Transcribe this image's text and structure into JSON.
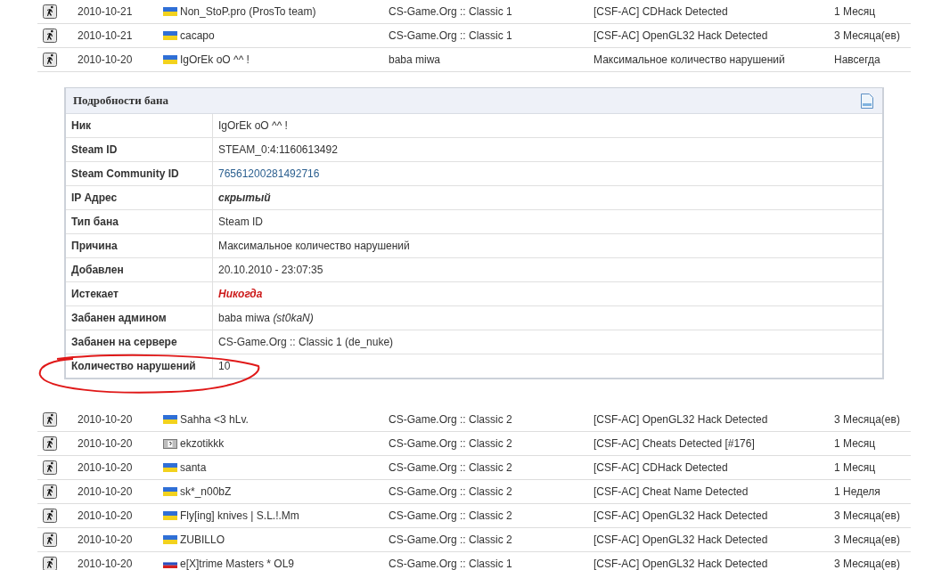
{
  "bans_top": [
    {
      "date": "2010-10-21",
      "kind": "ua",
      "nick": "Non_StoP.pro (ProsTo team)",
      "server": "CS-Game.Org :: Classic 1",
      "reason": "[CSF-AC] CDHack Detected",
      "length": "1 Месяц"
    },
    {
      "date": "2010-10-21",
      "kind": "ua",
      "nick": "cacapo",
      "server": "CS-Game.Org :: Classic 1",
      "reason": "[CSF-AC] OpenGL32 Hack Detected",
      "length": "3 Месяца(ев)"
    },
    {
      "date": "2010-10-20",
      "kind": "ua",
      "nick": "IgOrEk oO ^^ !",
      "server": "baba miwa",
      "reason": "Максимальное количество нарушений",
      "length": "Навсегда"
    }
  ],
  "details": {
    "title": "Подробности бана",
    "rows": [
      {
        "label": "Ник",
        "value": "IgOrEk oO ^^ !",
        "kind": "plain"
      },
      {
        "label": "Steam ID",
        "value": "STEAM_0:4:1160613492",
        "kind": "plain"
      },
      {
        "label": "Steam Community ID",
        "value": "76561200281492716",
        "kind": "link"
      },
      {
        "label": "IP Адрес",
        "value": "скрытый",
        "kind": "hidden"
      },
      {
        "label": "Тип бана",
        "value": "Steam ID",
        "kind": "plain"
      },
      {
        "label": "Причина",
        "value": "Максимальное количество нарушений",
        "kind": "plain"
      },
      {
        "label": "Добавлен",
        "value": "20.10.2010 - 23:07:35",
        "kind": "plain"
      },
      {
        "label": "Истекает",
        "value": "Никогда",
        "kind": "alert"
      },
      {
        "label": "Забанен админом",
        "value": "baba miwa *(st0kaN)*",
        "kind": "plain"
      },
      {
        "label": "Забанен на сервере",
        "value": "CS-Game.Org :: Classic 1 (de_nuke)",
        "kind": "plain"
      },
      {
        "label": "Количество нарушений",
        "value": "10",
        "kind": "plain"
      }
    ]
  },
  "bans_bottom": [
    {
      "date": "2010-10-20",
      "kind": "ua",
      "nick": "Sahha <3 hLv.",
      "server": "CS-Game.Org :: Classic 2",
      "reason": "[CSF-AC] OpenGL32 Hack Detected",
      "length": "3 Месяца(ев)"
    },
    {
      "date": "2010-10-20",
      "kind": "unknown",
      "nick": "ekzotikkk",
      "server": "CS-Game.Org :: Classic 2",
      "reason": "[CSF-AC] Cheats Detected [#176]",
      "length": "1 Месяц"
    },
    {
      "date": "2010-10-20",
      "kind": "ua",
      "nick": "santa",
      "server": "CS-Game.Org :: Classic 2",
      "reason": "[CSF-AC] CDHack Detected",
      "length": "1 Месяц"
    },
    {
      "date": "2010-10-20",
      "kind": "ua",
      "nick": "sk*_n00bZ",
      "server": "CS-Game.Org :: Classic 2",
      "reason": "[CSF-AC] Cheat Name Detected",
      "length": "1 Неделя"
    },
    {
      "date": "2010-10-20",
      "kind": "ua",
      "nick": "Fly[ing] knives | S.L.!.Mm",
      "server": "CS-Game.Org :: Classic 2",
      "reason": "[CSF-AC] OpenGL32 Hack Detected",
      "length": "3 Месяца(ев)"
    },
    {
      "date": "2010-10-20",
      "kind": "ua",
      "nick": "ZUBILLO",
      "server": "CS-Game.Org :: Classic 2",
      "reason": "[CSF-AC] OpenGL32 Hack Detected",
      "length": "3 Месяца(ев)"
    },
    {
      "date": "2010-10-20",
      "kind": "ru",
      "nick": "e[X]trime Masters * OL9",
      "server": "CS-Game.Org :: Classic 1",
      "reason": "[CSF-AC] OpenGL32 Hack Detected",
      "length": "3 Месяца(ев)"
    }
  ]
}
